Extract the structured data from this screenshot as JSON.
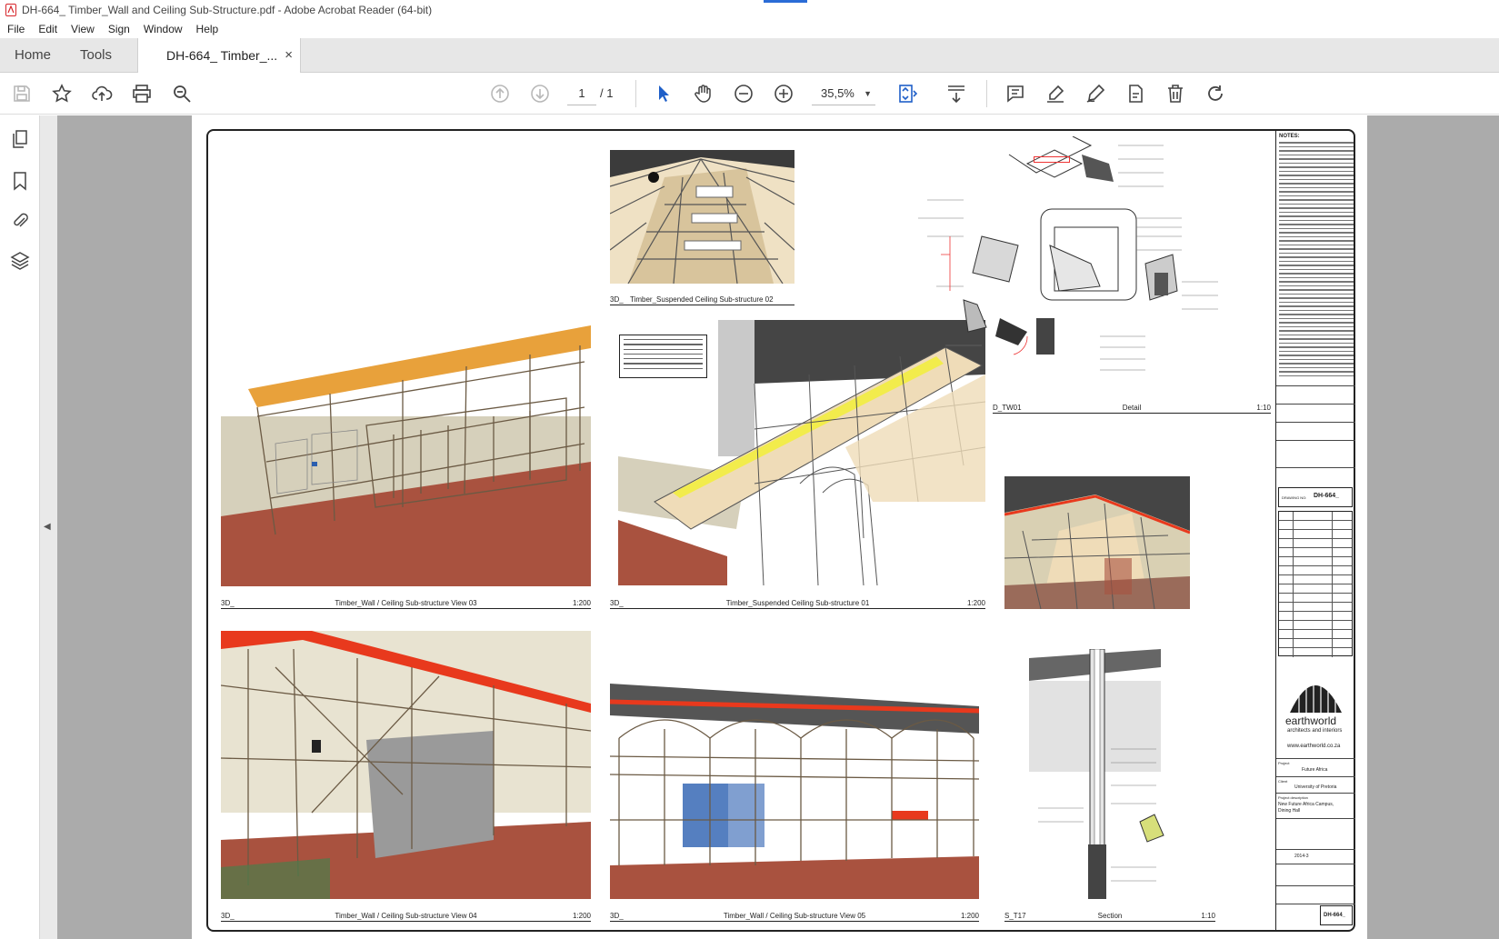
{
  "window": {
    "title": "DH-664_ Timber_Wall and Ceiling Sub-Structure.pdf - Adobe Acrobat Reader (64-bit)"
  },
  "menu": [
    "File",
    "Edit",
    "View",
    "Sign",
    "Window",
    "Help"
  ],
  "tabs": {
    "home": "Home",
    "tools": "Tools",
    "document": "DH-664_ Timber_...",
    "close_glyph": "×"
  },
  "toolbar": {
    "page_current": "1",
    "page_total": "/ 1",
    "zoom": "35,5%",
    "zoom_caret": "▼"
  },
  "sidebar": {
    "collapse_glyph": "◀"
  },
  "drawing": {
    "views": [
      {
        "ref": "3D_",
        "name": "Timber_Suspended Ceiling Sub-structure 02",
        "scale": ""
      },
      {
        "ref": "3D_",
        "name": "Timber_Wall / Ceiling Sub-structure View 03",
        "scale": "1:200"
      },
      {
        "ref": "3D_",
        "name": "Timber_Suspended Ceiling Sub-structure 01",
        "scale": "1:200"
      },
      {
        "ref": "D_TW01",
        "name": "Detail",
        "scale": "1:10"
      },
      {
        "ref": "3D_",
        "name": "Timber_Wall / Ceiling Sub-structure View 04",
        "scale": "1:200"
      },
      {
        "ref": "3D_",
        "name": "Timber_Wall / Ceiling Sub-structure View 05",
        "scale": "1:200"
      },
      {
        "ref": "S_T17",
        "name": "Section",
        "scale": "1:10"
      }
    ],
    "titleblock": {
      "notes_heading": "NOTES:",
      "drawing_no_label": "DRAWING NO:",
      "drawing_no": "DH-664_",
      "company": "earthworld",
      "company_sub": "architects and interiors",
      "website": "www.earthworld.co.za",
      "project_label": "Project",
      "project": "Future Africa",
      "client_label": "Client",
      "client": "University of Pretoria",
      "description_label": "Project description",
      "description": "New Future Africa Campus, Dining Hall",
      "project_no": "2014-3",
      "stamp_no": "DH-664_"
    }
  },
  "colors": {
    "accent_blue": "#2b6cd6",
    "timber": "#e9d6b0",
    "roof_red": "#e8391d",
    "floor_brown": "#a9523f",
    "workspace": "#ababab"
  }
}
